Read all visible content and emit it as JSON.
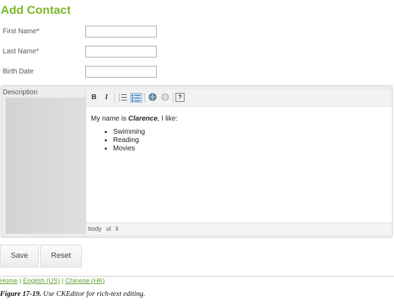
{
  "page_title": "Add Contact",
  "form": {
    "first_name_label": "First Name*",
    "first_name_value": "",
    "last_name_label": "Last Name*",
    "last_name_value": "",
    "birth_date_label": "Birth Date",
    "birth_date_value": "",
    "description_label": "Description"
  },
  "editor": {
    "toolbar": {
      "bold": "B",
      "italic": "I",
      "help": "?"
    },
    "content": {
      "intro_before": "My name is ",
      "intro_name": "Clarence",
      "intro_after": ", I like:",
      "list": [
        "Swimming",
        "Reading",
        "Movies"
      ]
    },
    "path": [
      "body",
      "ul",
      "li"
    ]
  },
  "buttons": {
    "save": "Save",
    "reset": "Reset"
  },
  "footer": {
    "home": "Home",
    "sep": " | ",
    "english": "English (US)",
    "chinese": "Chinese (HK)"
  },
  "caption": {
    "figure": "Figure 17-19.",
    "text": " Use CKEditor for rich-text editing."
  },
  "colors": {
    "title": "#7ab827",
    "link": "#5a9e2b"
  }
}
